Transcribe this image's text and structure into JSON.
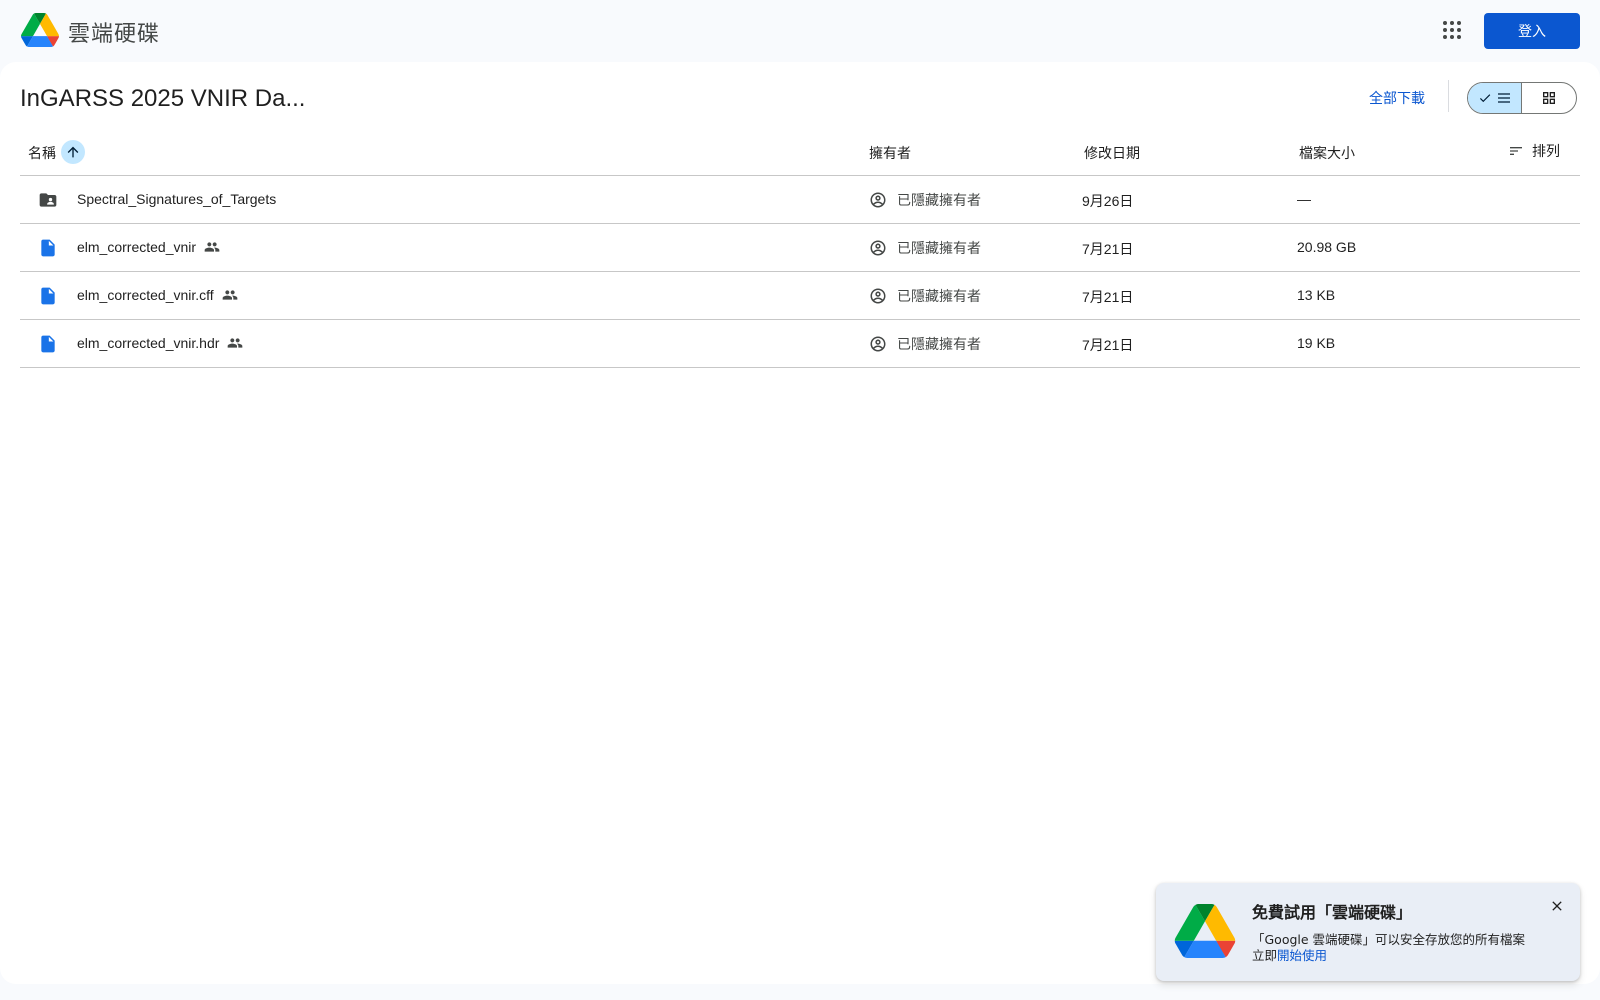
{
  "header": {
    "app_name": "雲端硬碟",
    "signin_label": "登入"
  },
  "folder": {
    "title": "InGARSS 2025 VNIR Da...",
    "download_all_label": "全部下載"
  },
  "table": {
    "columns": {
      "name": "名稱",
      "owner": "擁有者",
      "modified": "修改日期",
      "size": "檔案大小",
      "sort": "排列"
    },
    "rows": [
      {
        "type": "shared-folder",
        "name": "Spectral_Signatures_of_Targets",
        "shared": false,
        "owner": "已隱藏擁有者",
        "modified": "9月26日",
        "size": "—"
      },
      {
        "type": "file",
        "name": "elm_corrected_vnir",
        "shared": true,
        "owner": "已隱藏擁有者",
        "modified": "7月21日",
        "size": "20.98 GB"
      },
      {
        "type": "file",
        "name": "elm_corrected_vnir.cff",
        "shared": true,
        "owner": "已隱藏擁有者",
        "modified": "7月21日",
        "size": "13 KB"
      },
      {
        "type": "file",
        "name": "elm_corrected_vnir.hdr",
        "shared": true,
        "owner": "已隱藏擁有者",
        "modified": "7月21日",
        "size": "19 KB"
      }
    ]
  },
  "promo": {
    "title": "免費試用「雲端硬碟」",
    "description": "「Google 雲端硬碟」可以安全存放您的所有檔案",
    "line2_prefix": "立即",
    "link_label": "開始使用"
  },
  "colors": {
    "accent": "#0b57d0",
    "selected_bg": "#c2e7ff",
    "file_icon": "#1a73e8",
    "folder_icon": "#444746"
  }
}
